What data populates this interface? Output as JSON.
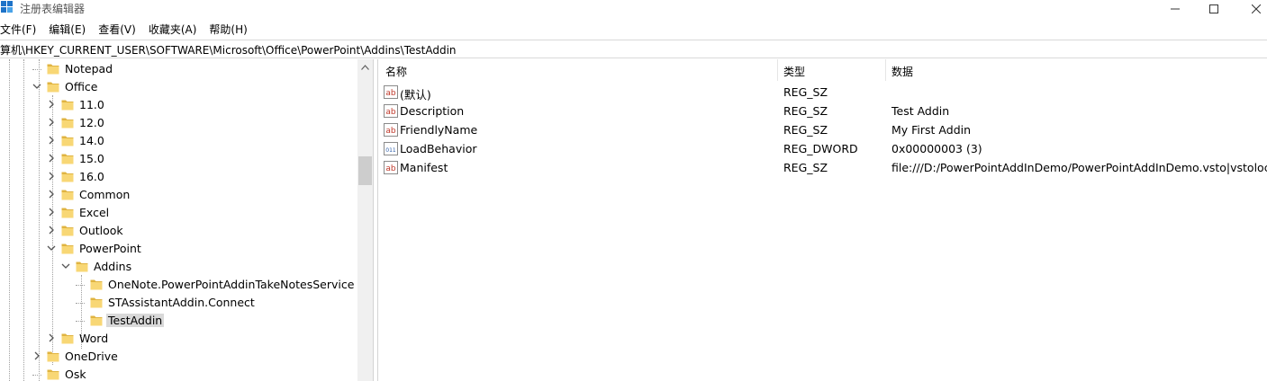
{
  "window": {
    "title": "注册表编辑器",
    "app_icon": "regedit-icon",
    "controls": [
      "minimize-icon",
      "maximize-icon",
      "close-icon"
    ]
  },
  "menu": [
    "文件(F)",
    "编辑(E)",
    "查看(V)",
    "收藏夹(A)",
    "帮助(H)"
  ],
  "address": "计算机\\HKEY_CURRENT_USER\\SOFTWARE\\Microsoft\\Office\\PowerPoint\\Addins\\TestAddin",
  "tree": [
    {
      "label": "Notepad",
      "level": 1,
      "expander": "none"
    },
    {
      "label": "Office",
      "level": 1,
      "expander": "expanded"
    },
    {
      "label": "11.0",
      "level": 2,
      "expander": "collapsed"
    },
    {
      "label": "12.0",
      "level": 2,
      "expander": "collapsed"
    },
    {
      "label": "14.0",
      "level": 2,
      "expander": "collapsed"
    },
    {
      "label": "15.0",
      "level": 2,
      "expander": "collapsed"
    },
    {
      "label": "16.0",
      "level": 2,
      "expander": "collapsed"
    },
    {
      "label": "Common",
      "level": 2,
      "expander": "collapsed"
    },
    {
      "label": "Excel",
      "level": 2,
      "expander": "collapsed"
    },
    {
      "label": "Outlook",
      "level": 2,
      "expander": "collapsed"
    },
    {
      "label": "PowerPoint",
      "level": 2,
      "expander": "expanded"
    },
    {
      "label": "Addins",
      "level": 3,
      "expander": "expanded"
    },
    {
      "label": "OneNote.PowerPointAddinTakeNotesService",
      "level": 4,
      "expander": "none"
    },
    {
      "label": "STAssistantAddin.Connect",
      "level": 4,
      "expander": "none"
    },
    {
      "label": "TestAddin",
      "level": 4,
      "expander": "none",
      "selected": true
    },
    {
      "label": "Word",
      "level": 2,
      "expander": "collapsed"
    },
    {
      "label": "OneDrive",
      "level": 1,
      "expander": "collapsed"
    },
    {
      "label": "Osk",
      "level": 1,
      "expander": "none"
    }
  ],
  "columns": {
    "name": "名称",
    "type": "类型",
    "data": "数据"
  },
  "values": [
    {
      "icon": "string-value-icon",
      "name": "(默认)",
      "type": "REG_SZ",
      "data": ""
    },
    {
      "icon": "string-value-icon",
      "name": "Description",
      "type": "REG_SZ",
      "data": "Test Addin"
    },
    {
      "icon": "string-value-icon",
      "name": "FriendlyName",
      "type": "REG_SZ",
      "data": "My First Addin"
    },
    {
      "icon": "binary-value-icon",
      "name": "LoadBehavior",
      "type": "REG_DWORD",
      "data": "0x00000003 (3)"
    },
    {
      "icon": "string-value-icon",
      "name": "Manifest",
      "type": "REG_SZ",
      "data": "file:///D:/PowerPointAddInDemo/PowerPointAddInDemo.vsto|vstolocal"
    }
  ],
  "colors": {
    "folder": "#f8d775",
    "folder_dark": "#e0b441",
    "selection": "#d9d9d9",
    "string_icon_red": "#c0392b",
    "binary_icon_blue": "#2a5ca8"
  }
}
